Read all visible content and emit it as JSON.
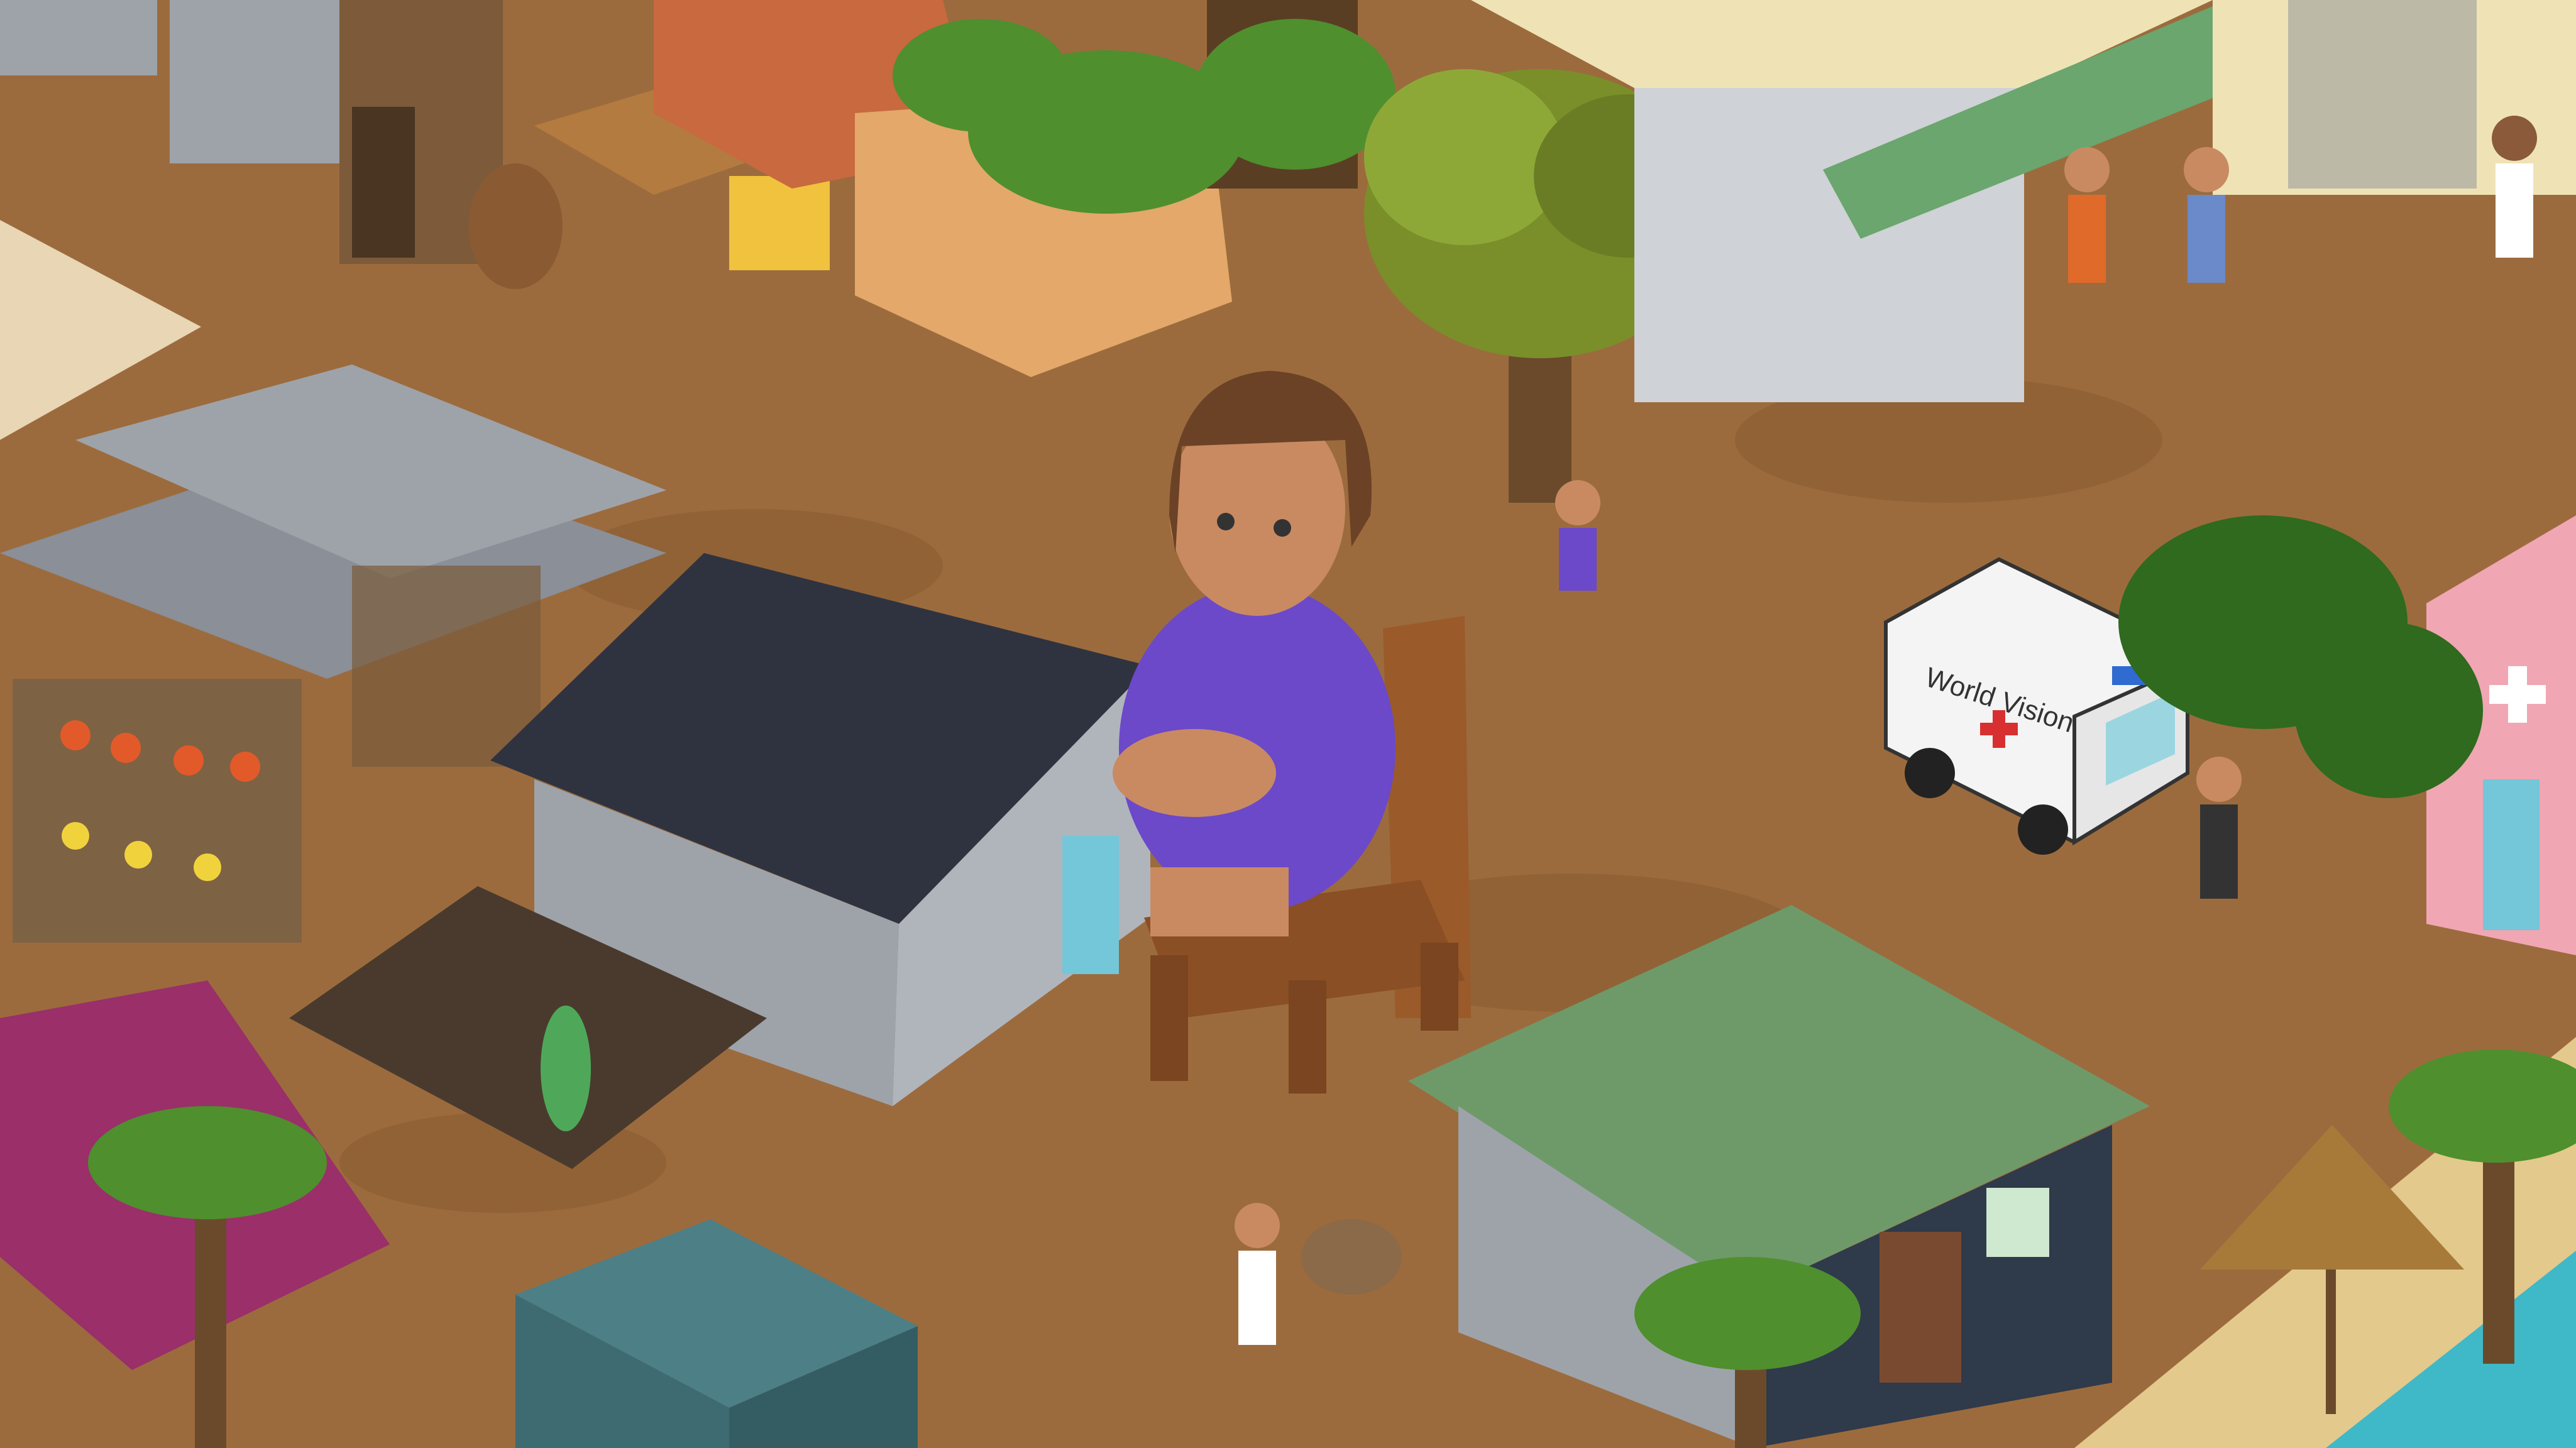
{
  "scene": {
    "ambulance_text": "World Vision",
    "colors": {
      "ground": "#9c6b3d",
      "ground_dark": "#86592f",
      "water": "#3fb8c8",
      "sand": "#e4c98c",
      "metal_roof": "#8a8f98",
      "dark_roof": "#2f3340",
      "green_roof": "#6e9a6a",
      "magenta_roof": "#9a2f6a",
      "container": "#3e6b72",
      "clinic": "#f1a6b4",
      "building_cream": "#efe3b6",
      "awning": "#6aa66d",
      "leaf": "#4f8f2e",
      "leaf_dark": "#2f6a1e",
      "trunk": "#6b4a2c",
      "rock": "#c8693f",
      "crate": "#f0c23d",
      "chair": "#9a5a2a",
      "dress": "#6b49c9",
      "skin": "#c98a62",
      "hair": "#6b4226"
    }
  }
}
